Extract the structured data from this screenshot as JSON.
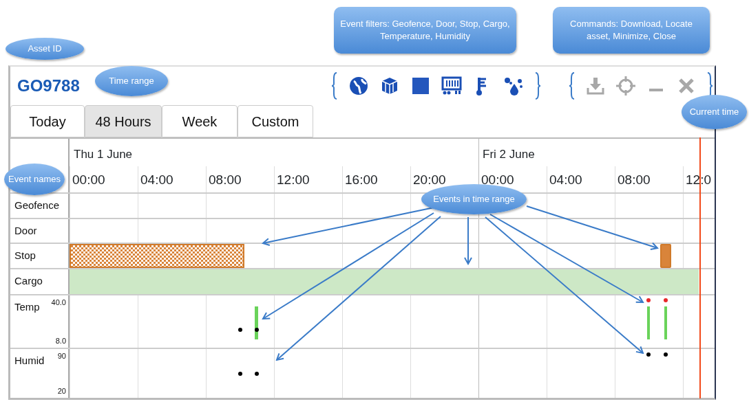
{
  "asset_id": "GO9788",
  "filters": [
    {
      "kind": "globe"
    },
    {
      "kind": "cube"
    },
    {
      "kind": "square"
    },
    {
      "kind": "cargo"
    },
    {
      "kind": "thermometer"
    },
    {
      "kind": "drops"
    }
  ],
  "commands": [
    {
      "kind": "download"
    },
    {
      "kind": "locate"
    },
    {
      "kind": "minimize"
    },
    {
      "kind": "close"
    }
  ],
  "tabs": [
    {
      "label": "Today",
      "selected": false
    },
    {
      "label": "48 Hours",
      "selected": true
    },
    {
      "label": "Week",
      "selected": false
    },
    {
      "label": "Custom",
      "selected": false
    }
  ],
  "days": [
    "Thu 1 June",
    "Fri 2 June"
  ],
  "hours": [
    "00:00",
    "04:00",
    "08:00",
    "12:00",
    "16:00",
    "20:00",
    "00:00",
    "04:00",
    "08:00",
    "12:0"
  ],
  "rows": [
    {
      "name": "Geofence",
      "kind": "empty"
    },
    {
      "name": "Door",
      "kind": "empty"
    },
    {
      "name": "Stop",
      "kind": "stops"
    },
    {
      "name": "Cargo",
      "kind": "band"
    },
    {
      "name": "Temp",
      "kind": "temperature",
      "scale_max": "40.0",
      "scale_min": "8.0"
    },
    {
      "name": "Humid",
      "kind": "humidity",
      "scale_max": "90",
      "scale_min": "20"
    }
  ],
  "callouts": [
    {
      "text": "Asset ID",
      "kind": "oval"
    },
    {
      "text": "Time range",
      "kind": "oval"
    },
    {
      "text": "Event filters: Geofence, Door, Stop, Cargo, Temperature, Humidity",
      "kind": "box"
    },
    {
      "text": "Commands: Download, Locate asset, Minimize, Close",
      "kind": "box"
    },
    {
      "text": "Current time",
      "kind": "oval"
    },
    {
      "text": "Event names",
      "kind": "oval"
    },
    {
      "text": "Events in time range",
      "kind": "oval"
    }
  ]
}
